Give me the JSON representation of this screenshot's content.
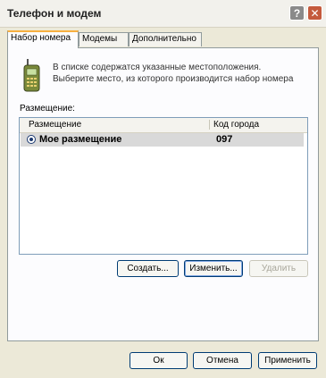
{
  "window": {
    "title": "Телефон и модем",
    "help_button": "?",
    "close_button": "✕"
  },
  "tabs": [
    {
      "label": "Набор номера",
      "active": true
    },
    {
      "label": "Модемы",
      "active": false
    },
    {
      "label": "Дополнительно",
      "active": false
    }
  ],
  "dialing": {
    "info_line1": "В списке содержатся указанные местоположения.",
    "info_line2": "Выберите место, из которого производится набор номера",
    "locations_label": "Размещение:",
    "table": {
      "columns": [
        "Размещение",
        "Код города"
      ],
      "rows": [
        {
          "location": "Мое размещение",
          "area_code": "097",
          "selected": true
        }
      ]
    },
    "buttons": {
      "create": "Создать...",
      "edit": "Изменить...",
      "delete": "Удалить"
    }
  },
  "footer": {
    "ok": "Ок",
    "cancel": "Отмена",
    "apply": "Применить"
  },
  "colors": {
    "window_bg": "#ece9d8",
    "active_tab_accent": "#f8b040",
    "close_button": "#c45a3c",
    "selected_row": "#d9d9d9"
  },
  "icons": {
    "phone": "phone-icon",
    "help": "help-icon",
    "close": "close-icon"
  }
}
